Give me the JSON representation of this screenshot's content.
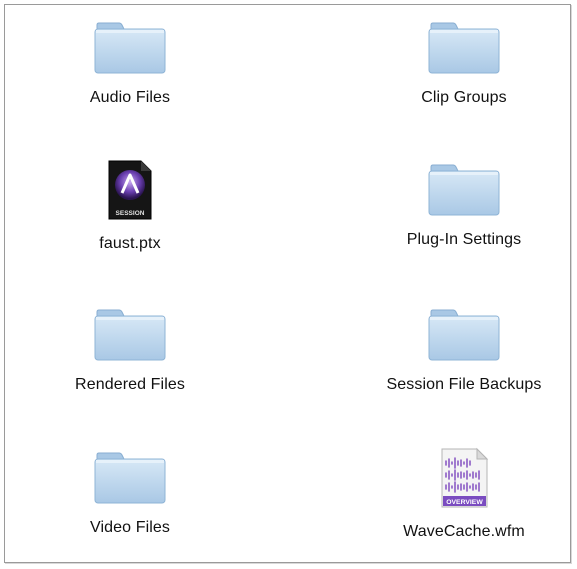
{
  "window": {
    "items": [
      {
        "label": "Audio Files",
        "icon": "folder-icon",
        "kind": "folder"
      },
      {
        "label": "Clip Groups",
        "icon": "folder-icon",
        "kind": "folder"
      },
      {
        "label": "faust.ptx",
        "icon": "pro-tools-session-icon",
        "kind": "session",
        "icon_text": "SESSION"
      },
      {
        "label": "Plug-In Settings",
        "icon": "folder-icon",
        "kind": "folder"
      },
      {
        "label": "Rendered Files",
        "icon": "folder-icon",
        "kind": "folder"
      },
      {
        "label": "Session File Backups",
        "icon": "folder-icon",
        "kind": "folder"
      },
      {
        "label": "Video Files",
        "icon": "folder-icon",
        "kind": "folder"
      },
      {
        "label": "WaveCache.wfm",
        "icon": "waveform-overview-icon",
        "kind": "wavecache",
        "icon_text": "OVERVIEW"
      }
    ]
  },
  "colors": {
    "folder_light": "#c9dff1",
    "folder_dark": "#8fb4d6",
    "session_bg": "#1a1a1a",
    "session_accent": "#8a63c9",
    "waveform": "#8b5cc4"
  }
}
